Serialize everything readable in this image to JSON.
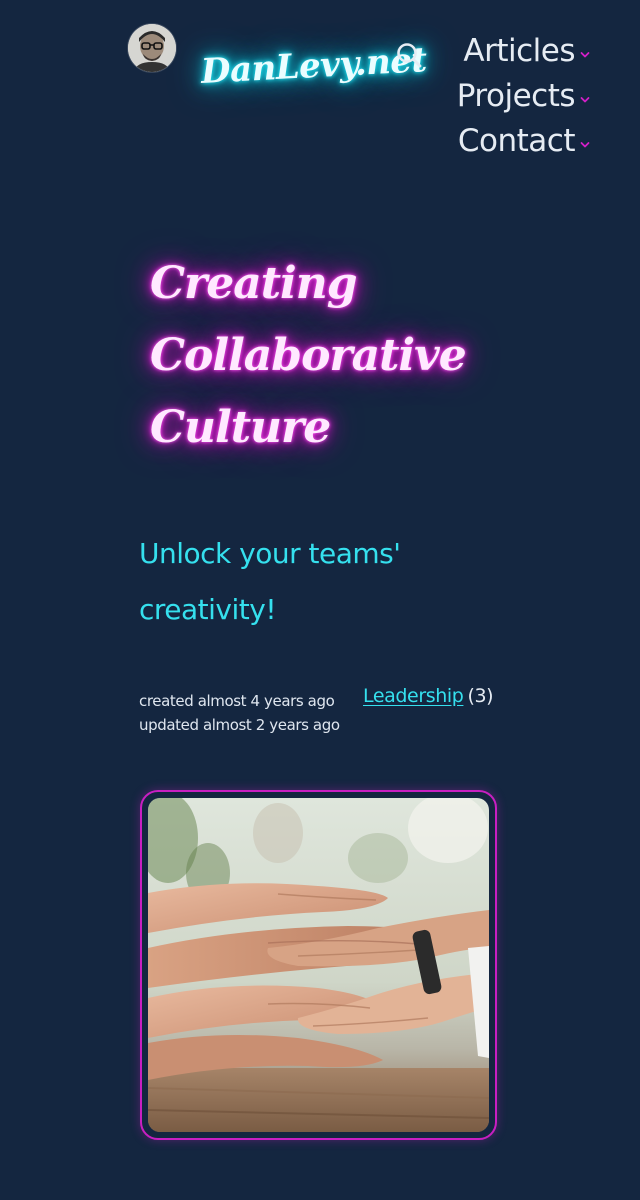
{
  "header": {
    "logo_text": "DanLevy.net",
    "avatar_icon": "profile-photo",
    "search_icon": "search-icon",
    "nav": [
      {
        "label": "Articles",
        "icon": "chevron-down-icon"
      },
      {
        "label": "Projects",
        "icon": "chevron-down-icon"
      },
      {
        "label": "Contact",
        "icon": "chevron-down-icon"
      }
    ]
  },
  "post": {
    "title": "Creating Collaborative Culture",
    "subtitle": "Unlock your teams' creativity!",
    "created": "created almost 4 years ago",
    "updated": "updated almost 2 years ago",
    "category": "Leadership",
    "category_count": "(3)",
    "hero_image": "stacked-hands-teamwork-photo"
  },
  "colors": {
    "background": "#142640",
    "logo_glow": "#13d8ea",
    "title_glow": "#e61bd8",
    "accent": "#35e0ee",
    "image_border": "#c81fc2"
  }
}
